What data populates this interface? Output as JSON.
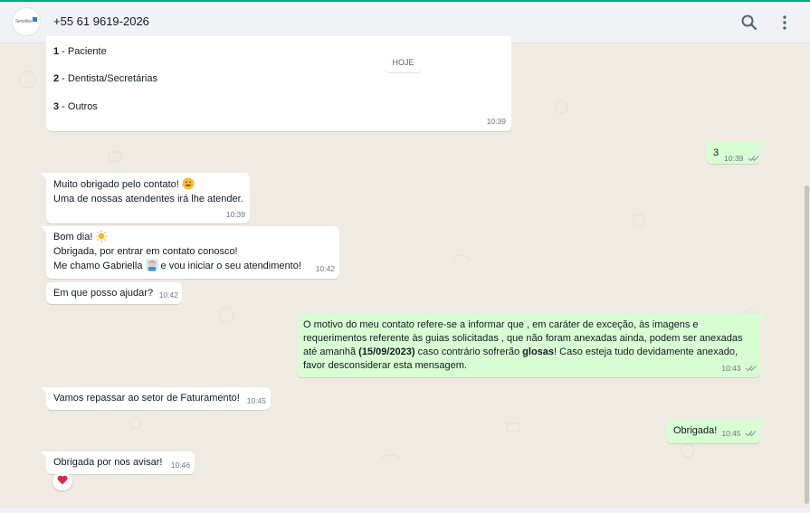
{
  "header": {
    "avatar_text": "Sensitive",
    "contact": "+55 61 9619-2026",
    "icons": [
      "search-icon",
      "menu-icon"
    ]
  },
  "day_separator": "HOJE",
  "menu_message": {
    "items": [
      {
        "num": "1",
        "text": " - Paciente"
      },
      {
        "num": "2",
        "text": " - Dentista/Secretárias"
      },
      {
        "num": "3",
        "text": " - Outros"
      }
    ],
    "time": "10:39"
  },
  "messages": [
    {
      "dir": "out",
      "lines": [
        "3"
      ],
      "time": "10:39",
      "status": "read"
    },
    {
      "dir": "in",
      "lines": [
        "Muito obrigado pelo contato! ",
        "Uma de nossas atendentes irá lhe atender."
      ],
      "emoji": [
        "grinning-face-emoji"
      ],
      "time": "10:39"
    },
    {
      "dir": "in",
      "lines": [
        "Bom dia! ",
        "Obrigada, por entrar em contato conosco!",
        "Me chamo Gabriella ",
        " e vou iniciar o seu atendimento!"
      ],
      "emoji": [
        "sun-emoji",
        "woman-technologist-emoji"
      ],
      "time": "10:42"
    },
    {
      "dir": "in",
      "lines": [
        "Em que posso ajudar?"
      ],
      "time": "10:42"
    },
    {
      "dir": "out",
      "lines": [
        "O motivo do meu contato refere-se a informar que , em caráter de exceção, às imagens e",
        "requerimentos referente às guias solicitadas , que não foram anexadas ainda, podem ser anexadas",
        "até amanhã ",
        "(15/09/2023)",
        " caso contrário sofrerão ",
        "glosas",
        "! Caso esteja tudo devidamente anexado,",
        "favor desconsiderar esta mensagem."
      ],
      "time": "10:43",
      "status": "read"
    },
    {
      "dir": "in",
      "lines": [
        "Vamos repassar ao setor de Faturamento!"
      ],
      "time": "10:45"
    },
    {
      "dir": "out",
      "lines": [
        "Obrigada!"
      ],
      "time": "10:45",
      "status": "read"
    },
    {
      "dir": "in",
      "lines": [
        "Obrigada por nos avisar!"
      ],
      "time": "10:46",
      "reaction": "red-heart-emoji"
    }
  ],
  "colors": {
    "chat_background": "#efeae2",
    "incoming_bubble": "#ffffff",
    "outgoing_bubble": "#d9fdd3",
    "header_background": "#f0f2f5",
    "accent": "#00a884",
    "timestamp": "#667781"
  }
}
